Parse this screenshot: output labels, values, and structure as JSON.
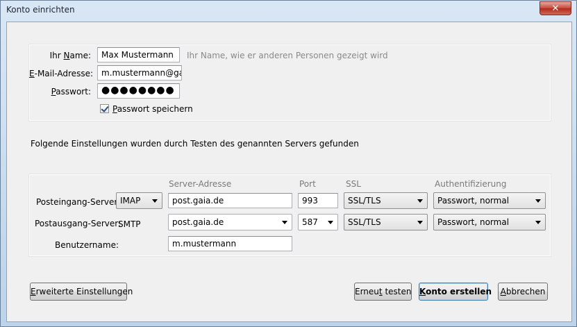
{
  "window": {
    "title": "Konto einrichten",
    "close_label": "✕"
  },
  "identity": {
    "name_label_pre": "Ihr ",
    "name_label_key": "N",
    "name_label_post": "ame:",
    "name_value": "Max Mustermann",
    "name_hint": "Ihr Name, wie er anderen Personen gezeigt wird",
    "email_label_key": "E",
    "email_label_post": "-Mail-Adresse:",
    "email_value": "m.mustermann@gaia.de",
    "password_label_key": "P",
    "password_label_post": "asswort:",
    "password_value": "●●●●●●●●",
    "remember_key": "P",
    "remember_post": "asswort speichern"
  },
  "status_message": "Folgende Einstellungen wurden durch Testen des genannten Servers gefunden",
  "server": {
    "headers": {
      "address": "Server-Adresse",
      "port": "Port",
      "ssl": "SSL",
      "auth": "Authentifizierung"
    },
    "incoming": {
      "label": "Posteingang-Server:",
      "protocol": "IMAP",
      "address": "post.gaia.de",
      "port": "993",
      "ssl": "SSL/TLS",
      "auth": "Passwort, normal"
    },
    "outgoing": {
      "label": "Postausgang-Server:",
      "protocol": "SMTP",
      "address": "post.gaia.de",
      "port": "587",
      "ssl": "SSL/TLS",
      "auth": "Passwort, normal"
    },
    "username": {
      "label": "Benutzername:",
      "value": "m.mustermann"
    }
  },
  "buttons": {
    "advanced_key": "E",
    "advanced_post": "rweiterte Einstellungen",
    "retest_pre": "Erneu",
    "retest_key": "t",
    "retest_post": " testen",
    "create_key": "K",
    "create_post": "onto erstellen",
    "cancel_key": "A",
    "cancel_post": "bbrechen"
  }
}
